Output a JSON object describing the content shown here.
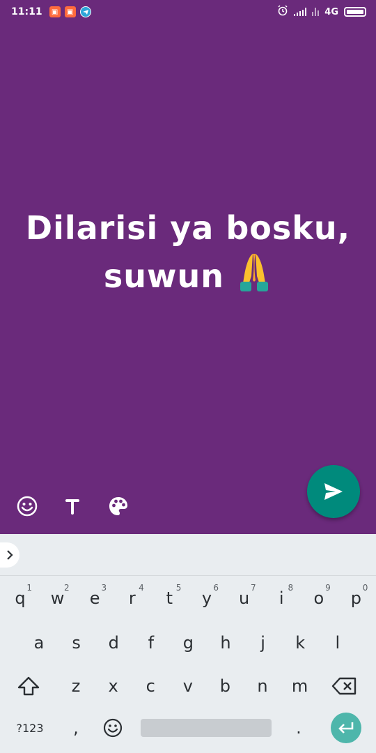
{
  "status_bar": {
    "time": "11:11",
    "network": "4G",
    "notification_icons": [
      "calendar-icon",
      "calendar-icon",
      "telegram-icon"
    ],
    "right_icons": [
      "alarm-icon",
      "signal-icon",
      "signal-icon",
      "battery-icon"
    ]
  },
  "status_editor": {
    "text": "Dilarisi ya bosku, suwun",
    "emoji": "folded-hands",
    "background_color": "#6a2a7b",
    "tools": [
      "emoji-icon",
      "text-icon",
      "palette-icon"
    ],
    "send_button_color": "#008a7c"
  },
  "keyboard": {
    "row1": [
      {
        "label": "q",
        "hint": "1"
      },
      {
        "label": "w",
        "hint": "2"
      },
      {
        "label": "e",
        "hint": "3"
      },
      {
        "label": "r",
        "hint": "4"
      },
      {
        "label": "t",
        "hint": "5"
      },
      {
        "label": "y",
        "hint": "6"
      },
      {
        "label": "u",
        "hint": "7"
      },
      {
        "label": "i",
        "hint": "8"
      },
      {
        "label": "o",
        "hint": "9"
      },
      {
        "label": "p",
        "hint": "0"
      }
    ],
    "row2": [
      "a",
      "s",
      "d",
      "f",
      "g",
      "h",
      "j",
      "k",
      "l"
    ],
    "row3": [
      "z",
      "x",
      "c",
      "v",
      "b",
      "n",
      "m"
    ],
    "symbols_label": "?123",
    "comma": ",",
    "period": "."
  }
}
